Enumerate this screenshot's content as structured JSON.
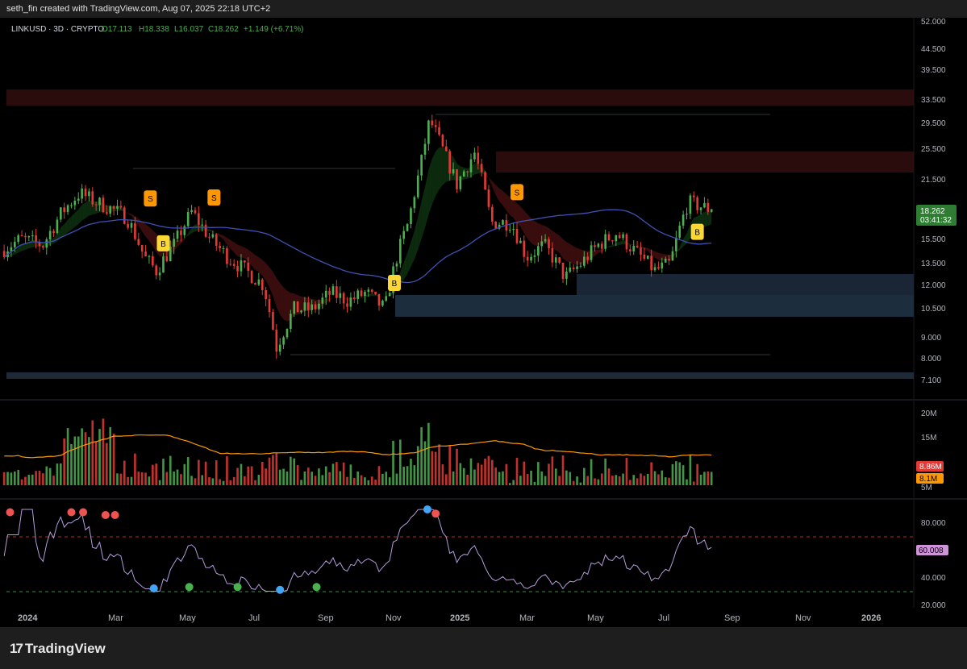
{
  "header": {
    "caption": "seth_fin created with TradingView.com, Aug 07, 2025 22:18 UTC+2"
  },
  "symbol": {
    "name": "LINKUSD · 3D · CRYPTO",
    "open": "O17.113",
    "high": "H18.338",
    "low": "L16.037",
    "close": "C18.262",
    "change": "+1.149 (+6.71%)"
  },
  "price_axis": {
    "labels": [
      "52.000",
      "44.500",
      "39.500",
      "33.500",
      "29.500",
      "25.500",
      "21.500",
      "15.500",
      "13.500",
      "12.000",
      "10.500",
      "9.000",
      "8.000",
      "7.100"
    ],
    "last_price": "18.262",
    "countdown": "03:41:32"
  },
  "volume_axis": {
    "labels": [
      "20M",
      "15M",
      "5M"
    ],
    "vol_label": "8.86M",
    "ma_label": "8.1M"
  },
  "rsi_axis": {
    "labels": [
      "80.000",
      "40.000",
      "20.000"
    ],
    "current": "60.008"
  },
  "time_axis": {
    "labels": [
      "2024",
      "Mar",
      "May",
      "Jul",
      "Sep",
      "Nov",
      "2025",
      "Mar",
      "May",
      "Jul",
      "Sep",
      "Nov",
      "2026"
    ]
  },
  "signals": {
    "buy_label": "B",
    "sell_label": "S"
  },
  "colors": {
    "up": "#4caf50",
    "down": "#e53935",
    "ma": "#3f51b5",
    "vol_ma": "#ff9800",
    "rsi": "#b39ddb",
    "signal_buy": "#fdd835",
    "signal_sell": "#ff9800"
  },
  "chart_data": {
    "type": "line",
    "symbol": "LINKUSD",
    "ylim": [
      7.1,
      52
    ],
    "y_scale": "log",
    "series": [
      {
        "dates": [
          "2023-12-15",
          "2024-01-01",
          "2024-01-20",
          "2024-02-05",
          "2024-02-20",
          "2024-03-05",
          "2024-03-15",
          "2024-03-31",
          "2024-04-15",
          "2024-04-25",
          "2024-05-10",
          "2024-05-25",
          "2024-06-10",
          "2024-06-25",
          "2024-07-10",
          "2024-07-25",
          "2024-08-05",
          "2024-08-20",
          "2024-09-05",
          "2024-09-20",
          "2024-10-05",
          "2024-10-20",
          "2024-11-05",
          "2024-11-15",
          "2024-11-25",
          "2024-12-05",
          "2024-12-13",
          "2024-12-25",
          "2025-01-05",
          "2025-01-20",
          "2025-02-03",
          "2025-02-20",
          "2025-03-05",
          "2025-03-20",
          "2025-04-07",
          "2025-04-20",
          "2025-05-05",
          "2025-05-20",
          "2025-06-05",
          "2025-06-22",
          "2025-07-05",
          "2025-07-20",
          "2025-08-07"
        ],
        "values": [
          14.5,
          15.5,
          15,
          18,
          20,
          19,
          18.5,
          17.5,
          14,
          13,
          15,
          18,
          15.5,
          14,
          13,
          12,
          8.5,
          10.5,
          10.5,
          11.5,
          11,
          11.5,
          10.5,
          14,
          17,
          23,
          30,
          25,
          21,
          25,
          17,
          17,
          14,
          15,
          12.5,
          13.5,
          15,
          16,
          14.5,
          13,
          13.5,
          19,
          18.3
        ]
      }
    ]
  }
}
